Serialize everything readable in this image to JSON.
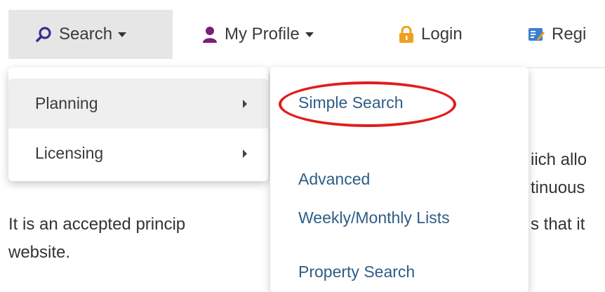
{
  "navbar": {
    "search_label": "Search",
    "profile_label": "My Profile",
    "login_label": "Login",
    "register_label": "Regi"
  },
  "submenu_categories": {
    "items": [
      {
        "label": "Planning"
      },
      {
        "label": "Licensing"
      }
    ]
  },
  "submenu_planning": {
    "items": [
      {
        "label": "Simple Search"
      },
      {
        "label": "Advanced"
      },
      {
        "label": "Weekly/Monthly Lists"
      },
      {
        "label": "Property Search"
      }
    ]
  },
  "background_text": {
    "line1_right": "iich allo",
    "line2_right": "tinuous",
    "line3_left": "It is an accepted princip",
    "line3_right": "s that it",
    "line4_left": "website."
  },
  "colors": {
    "highlight": "#e01d1d",
    "link": "#2f5d86",
    "search_icon": "#3b2c8f",
    "profile_icon": "#7b1f7a",
    "login_icon": "#f0a020",
    "register_icon": "#3a7fd0"
  }
}
